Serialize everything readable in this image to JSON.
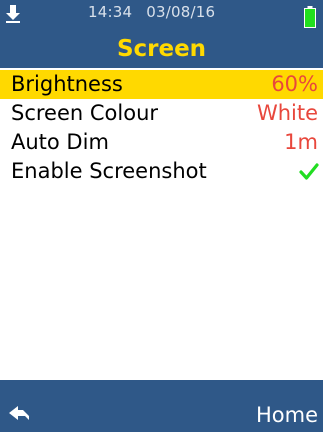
{
  "status": {
    "time": "14:34",
    "date": "03/08/16",
    "download_icon": "download-arrow-icon",
    "battery_icon": "battery-icon",
    "battery_color": "#22e01e"
  },
  "header": {
    "title": "Screen",
    "title_color": "#ffd900",
    "background": "#2f5888"
  },
  "menu": {
    "items": [
      {
        "label": "Brightness",
        "value": "60%",
        "selected": true
      },
      {
        "label": "Screen Colour",
        "value": "White",
        "selected": false
      },
      {
        "label": "Auto Dim",
        "value": "1m",
        "selected": false
      },
      {
        "label": "Enable Screenshot",
        "value_icon": "check-icon",
        "checked": true,
        "selected": false
      }
    ],
    "highlight_color": "#ffd900",
    "value_color": "#e8473c",
    "check_color": "#22dd22"
  },
  "footer": {
    "back_icon": "back-arrow-icon",
    "home_label": "Home"
  }
}
